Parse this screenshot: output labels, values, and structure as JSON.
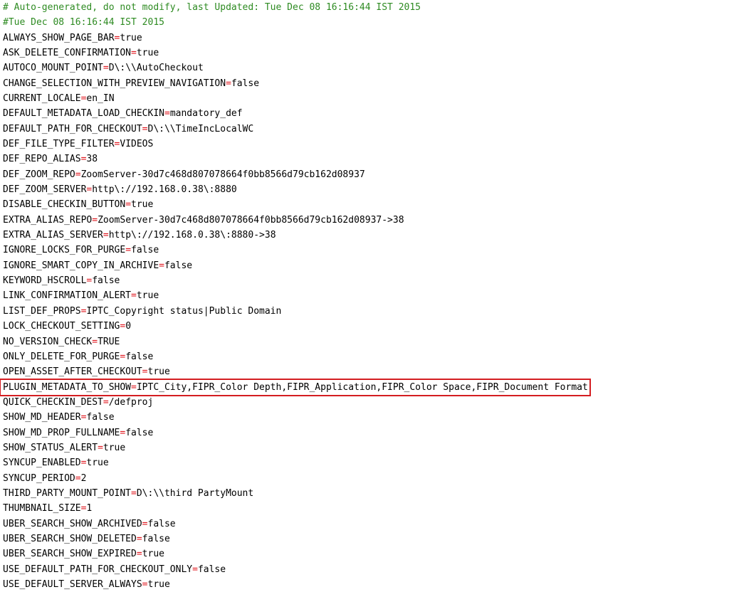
{
  "comments": [
    "# Auto-generated, do not modify, last Updated: Tue Dec 08 16:16:44 IST 2015",
    "#Tue Dec 08 16:16:44 IST 2015"
  ],
  "colors": {
    "comment": "#2e8b22",
    "equals": "#e0141c",
    "highlight_border": "#d41d21"
  },
  "highlighted_line_index": 24,
  "properties": [
    {
      "key": "ALWAYS_SHOW_PAGE_BAR",
      "value": "true"
    },
    {
      "key": "ASK_DELETE_CONFIRMATION",
      "value": "true"
    },
    {
      "key": "AUTOCO_MOUNT_POINT",
      "value": "D\\:\\\\AutoCheckout"
    },
    {
      "key": "CHANGE_SELECTION_WITH_PREVIEW_NAVIGATION",
      "value": "false"
    },
    {
      "key": "CURRENT_LOCALE",
      "value": "en_IN"
    },
    {
      "key": "DEFAULT_METADATA_LOAD_CHECKIN",
      "value": "mandatory_def"
    },
    {
      "key": "DEFAULT_PATH_FOR_CHECKOUT",
      "value": "D\\:\\\\TimeIncLocalWC"
    },
    {
      "key": "DEF_FILE_TYPE_FILTER",
      "value": "VIDEOS"
    },
    {
      "key": "DEF_REPO_ALIAS",
      "value": "38"
    },
    {
      "key": "DEF_ZOOM_REPO",
      "value": "ZoomServer-30d7c468d807078664f0bb8566d79cb162d08937"
    },
    {
      "key": "DEF_ZOOM_SERVER",
      "value": "http\\://192.168.0.38\\:8880"
    },
    {
      "key": "DISABLE_CHECKIN_BUTTON",
      "value": "true"
    },
    {
      "key": "EXTRA_ALIAS_REPO",
      "value": "ZoomServer-30d7c468d807078664f0bb8566d79cb162d08937->38"
    },
    {
      "key": "EXTRA_ALIAS_SERVER",
      "value": "http\\://192.168.0.38\\:8880->38"
    },
    {
      "key": "IGNORE_LOCKS_FOR_PURGE",
      "value": "false"
    },
    {
      "key": "IGNORE_SMART_COPY_IN_ARCHIVE",
      "value": "false"
    },
    {
      "key": "KEYWORD_HSCROLL",
      "value": "false"
    },
    {
      "key": "LINK_CONFIRMATION_ALERT",
      "value": "true"
    },
    {
      "key": "LIST_DEF_PROPS",
      "value": "IPTC_Copyright status|Public Domain"
    },
    {
      "key": "LOCK_CHECKOUT_SETTING",
      "value": "0"
    },
    {
      "key": "NO_VERSION_CHECK",
      "value": "TRUE"
    },
    {
      "key": "ONLY_DELETE_FOR_PURGE",
      "value": "false"
    },
    {
      "key": "OPEN_ASSET_AFTER_CHECKOUT",
      "value": "true"
    },
    {
      "key": "PLUGIN_METADATA_TO_SHOW",
      "value": "IPTC_City,FIPR_Color Depth,FIPR_Application,FIPR_Color Space,FIPR_Document Format"
    },
    {
      "key": "QUICK_CHECKIN_DEST",
      "value": "/defproj"
    },
    {
      "key": "SHOW_MD_HEADER",
      "value": "false"
    },
    {
      "key": "SHOW_MD_PROP_FULLNAME",
      "value": "false"
    },
    {
      "key": "SHOW_STATUS_ALERT",
      "value": "true"
    },
    {
      "key": "SYNCUP_ENABLED",
      "value": "true"
    },
    {
      "key": "SYNCUP_PERIOD",
      "value": "2"
    },
    {
      "key": "THIRD_PARTY_MOUNT_POINT",
      "value": "D\\:\\\\third PartyMount"
    },
    {
      "key": "THUMBNAIL_SIZE",
      "value": "1"
    },
    {
      "key": "UBER_SEARCH_SHOW_ARCHIVED",
      "value": "false"
    },
    {
      "key": "UBER_SEARCH_SHOW_DELETED",
      "value": "false"
    },
    {
      "key": "UBER_SEARCH_SHOW_EXPIRED",
      "value": "true"
    },
    {
      "key": "USE_DEFAULT_PATH_FOR_CHECKOUT_ONLY",
      "value": "false"
    },
    {
      "key": "USE_DEFAULT_SERVER_ALWAYS",
      "value": "true"
    }
  ]
}
